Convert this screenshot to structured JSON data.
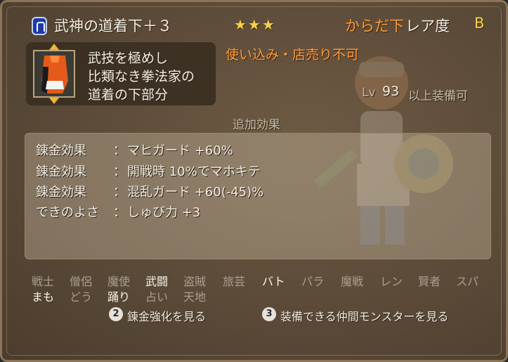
{
  "header": {
    "title": "武神の道着下＋３",
    "stars": "★★★",
    "category": "からだ下",
    "rarity_label": "レア度",
    "rarity_value": "B"
  },
  "description": {
    "lines": [
      "武技を極めし",
      "比類なき拳法家の",
      "道着の下部分"
    ]
  },
  "restriction": "使い込み・店売り不可",
  "level": {
    "prefix": "Lv",
    "value": "93",
    "suffix": "以上装備可"
  },
  "effects": {
    "heading": "追加効果",
    "rows": [
      {
        "label": "錬金効果",
        "sep": "：",
        "value": "マヒガード +60%"
      },
      {
        "label": "錬金効果",
        "sep": "：",
        "value": "開戦時 10%でマホキテ"
      },
      {
        "label": "錬金効果",
        "sep": "：",
        "value": "混乱ガード +60(-45)%"
      },
      {
        "label": "できのよさ",
        "sep": "：",
        "value": "しゅび力 +3"
      }
    ]
  },
  "jobs": {
    "row1": [
      {
        "name": "戦士",
        "on": false
      },
      {
        "name": "僧侶",
        "on": false
      },
      {
        "name": "魔使",
        "on": false
      },
      {
        "name": "武闘",
        "on": true
      },
      {
        "name": "盗賊",
        "on": false
      },
      {
        "name": "旅芸",
        "on": false
      },
      {
        "name": "バト",
        "on": true
      },
      {
        "name": "パラ",
        "on": false
      },
      {
        "name": "魔戦",
        "on": false
      },
      {
        "name": "レン",
        "on": false
      },
      {
        "name": "賢者",
        "on": false
      },
      {
        "name": "スパ",
        "on": false
      }
    ],
    "row2": [
      {
        "name": "まも",
        "on": true
      },
      {
        "name": "どう",
        "on": false
      },
      {
        "name": "踊り",
        "on": true
      },
      {
        "name": "占い",
        "on": false
      },
      {
        "name": "天地",
        "on": false
      }
    ]
  },
  "actions": [
    {
      "key": "2",
      "label": "錬金強化を見る"
    },
    {
      "key": "3",
      "label": "装備できる仲間モンスターを見る"
    }
  ],
  "colors": {
    "panel": "#5b4a38",
    "highlight_orange": "#ff9b3a",
    "star_yellow": "#f4d24a"
  }
}
